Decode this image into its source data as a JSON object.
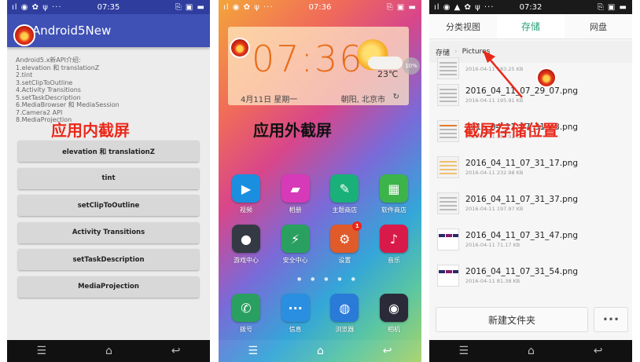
{
  "status": {
    "p1": {
      "signals": "ıl ◉ ✿ ψ ···",
      "time": "07:35",
      "right": "⎘ ▣ ▬"
    },
    "p2": {
      "signals": "ıl ◉ ✿ ψ ···",
      "time": "07:36",
      "right": "⎘ ▣ ▬"
    },
    "p3": {
      "signals": "ıl ◉ ▲ ✿ ψ ···",
      "time": "07:32",
      "right": "⎘ ▣ ▬"
    }
  },
  "phone1": {
    "app_title": "Android5New",
    "intro_lines": [
      "Android5.x新API介绍:",
      " 1.elevation 和 translationZ",
      " 2.tint",
      " 3.setClipToOutline",
      " 4.Activity Transitions",
      " 5.setTaskDescription",
      " 6.MediaBrowser 和 MediaSession",
      " 7.Camera2 API",
      " 8.MediaProjection"
    ],
    "overlay_label": "应用内截屏",
    "buttons": [
      "elevation 和 translationZ",
      "tint",
      "setClipToOutline",
      "Activity Transitions",
      "setTaskDescription",
      "MediaProjection"
    ]
  },
  "phone2": {
    "clock": "07:36",
    "temperature": "23℃",
    "date": "4月11日 星期一",
    "city": "朝阳, 北京市",
    "refresh_icon": "↻",
    "badge": "10%",
    "overlay_label": "应用外截屏",
    "apps_row1": [
      {
        "label": "视频",
        "icon": "video-icon",
        "glyph": "▶",
        "color": "#1a8fe0"
      },
      {
        "label": "相册",
        "icon": "gallery-icon",
        "glyph": "▰",
        "color": "#d63ab8"
      },
      {
        "label": "主题商店",
        "icon": "theme-store-icon",
        "glyph": "✎",
        "color": "#1ab07a"
      },
      {
        "label": "软件商店",
        "icon": "app-store-icon",
        "glyph": "▦",
        "color": "#3cb44a"
      }
    ],
    "apps_row2": [
      {
        "label": "游戏中心",
        "icon": "game-center-icon",
        "glyph": "●",
        "color": "#333a44"
      },
      {
        "label": "安全中心",
        "icon": "security-center-icon",
        "glyph": "⚡",
        "color": "#2aa060"
      },
      {
        "label": "设置",
        "icon": "settings-icon",
        "glyph": "⚙",
        "color": "#e05a2a",
        "badge": "1"
      },
      {
        "label": "音乐",
        "icon": "music-icon",
        "glyph": "♪",
        "color": "#d81a4a"
      }
    ],
    "pager_dots": "● ● ● ● ●",
    "dock": [
      {
        "label": "拨号",
        "icon": "phone-icon",
        "glyph": "✆",
        "color": "#2aa060"
      },
      {
        "label": "信息",
        "icon": "messages-icon",
        "glyph": "···",
        "color": "#2a8fe0"
      },
      {
        "label": "浏览器",
        "icon": "browser-icon",
        "glyph": "◍",
        "color": "#2a7ad8"
      },
      {
        "label": "相机",
        "icon": "camera-icon",
        "glyph": "◉",
        "color": "#2a2a38"
      }
    ]
  },
  "phone3": {
    "tabs": [
      "分类视图",
      "存储",
      "网盘"
    ],
    "active_tab": "存储",
    "breadcrumb": [
      "存储",
      "Pictures"
    ],
    "overlay_label": "截屏存储位置",
    "files": [
      {
        "name": "",
        "date": "2016-04-11",
        "size": "183.25 KB"
      },
      {
        "name": "2016_04_11_07_29_07.png",
        "date": "2016-04-11",
        "size": "195.91 KB"
      },
      {
        "name": "2016_04_11_07_31_13.png",
        "date": "2016-04-11",
        "size": "384.92 KB"
      },
      {
        "name": "2016_04_11_07_31_17.png",
        "date": "2016-04-11",
        "size": "232.98 KB"
      },
      {
        "name": "2016_04_11_07_31_37.png",
        "date": "2016-04-11",
        "size": "197.97 KB"
      },
      {
        "name": "2016_04_11_07_31_47.png",
        "date": "2016-04-11",
        "size": "71.17 KB"
      },
      {
        "name": "2016_04_11_07_31_54.png",
        "date": "2016-04-11",
        "size": "81.38 KB"
      }
    ],
    "new_folder_label": "新建文件夹",
    "more_label": "•••"
  },
  "navbar": {
    "menu": "☰",
    "home": "⌂",
    "back": "↩"
  }
}
